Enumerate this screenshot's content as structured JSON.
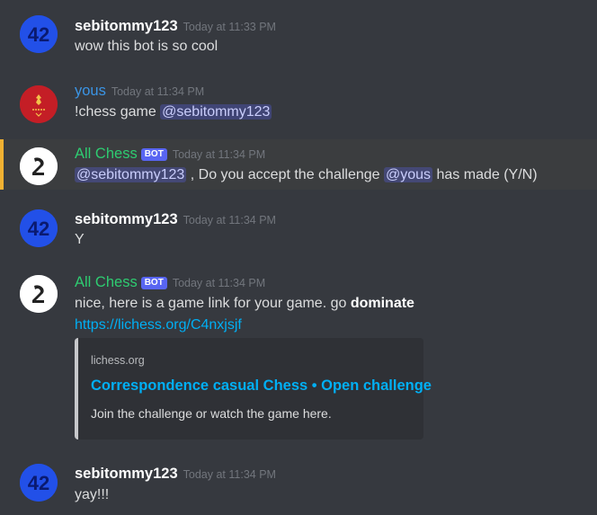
{
  "messages": [
    {
      "username": "sebitommy123",
      "timestamp": "Today at 11:33 PM",
      "text": "wow this bot is so cool"
    },
    {
      "username": "yous",
      "timestamp": "Today at 11:34 PM",
      "text": "!chess game ",
      "mention": "@sebitommy123"
    },
    {
      "username": "All Chess",
      "bot_tag": "BOT",
      "timestamp": "Today at 11:34 PM",
      "mention1": "@sebitommy123",
      "text1": " , Do you accept the challenge ",
      "mention2": "@yous",
      "text2": " has made (Y/N)"
    },
    {
      "username": "sebitommy123",
      "timestamp": "Today at 11:34 PM",
      "text": "Y"
    },
    {
      "username": "All Chess",
      "bot_tag": "BOT",
      "timestamp": "Today at 11:34 PM",
      "text": "nice, here is a game link for your game. go ",
      "bold": "dominate",
      "link": "https://lichess.org/C4nxjsjf",
      "embed": {
        "provider": "lichess.org",
        "title": "Correspondence casual Chess • Open challenge",
        "description": "Join the challenge or watch the game here."
      }
    },
    {
      "username": "sebitommy123",
      "timestamp": "Today at 11:34 PM",
      "text": "yay!!!"
    }
  ],
  "avatars": {
    "sebitommy123": {
      "label": "42",
      "color": "#2250e8",
      "icon": "digit-42-icon"
    },
    "yous": {
      "color": "#c41e26",
      "icon": "liverpool-crest-icon"
    },
    "allchess": {
      "color": "#ffffff",
      "icon": "chess-knight-icon"
    }
  },
  "colors": {
    "background": "#36393f",
    "highlight_border": "#f0b132",
    "mention_bg": "#5865f2",
    "link": "#00aff4",
    "bot_name": "#2ecc71",
    "user_yous": "#3b95e6"
  }
}
